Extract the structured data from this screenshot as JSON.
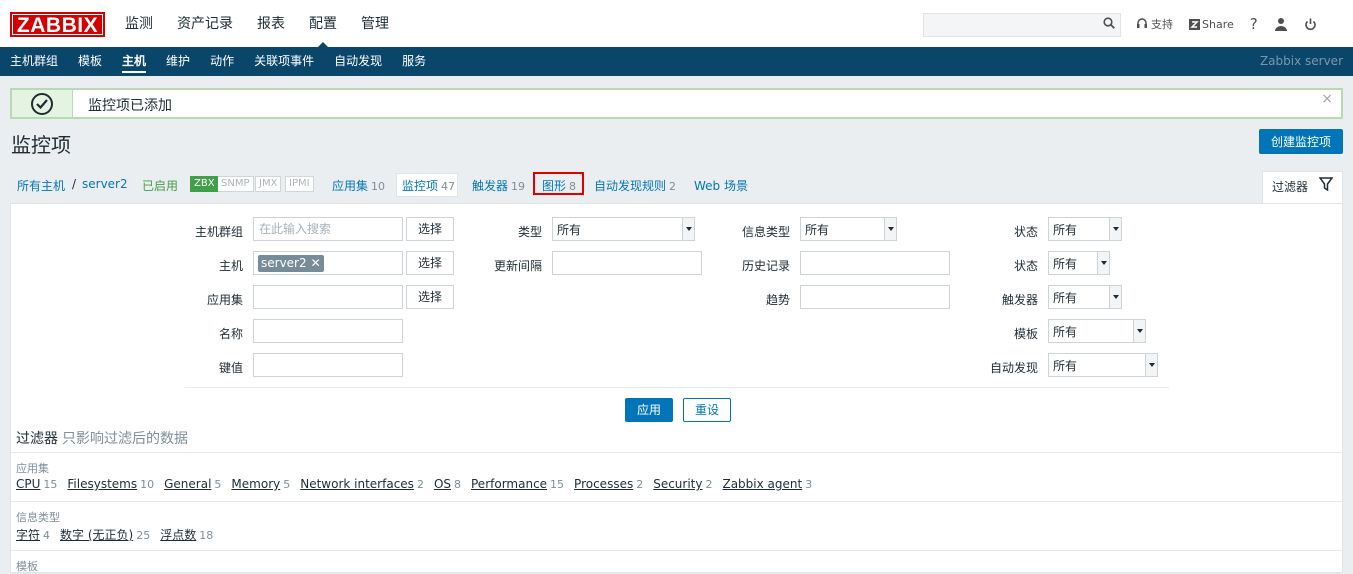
{
  "brand": {
    "logo": "ZABBIX"
  },
  "main_menu": [
    "监测",
    "资产记录",
    "报表",
    "配置",
    "管理"
  ],
  "top_icons": {
    "support": "支持",
    "share": "Share",
    "help": "?"
  },
  "sub_menu": [
    "主机群组",
    "模板",
    "主机",
    "维护",
    "动作",
    "关联项事件",
    "自动发现",
    "服务"
  ],
  "server_name": "Zabbix server",
  "message": {
    "text": "监控项已添加",
    "close": "×"
  },
  "page": {
    "title": "监控项",
    "create_button": "创建监控项"
  },
  "breadcrumb": {
    "all_hosts": "所有主机",
    "separator": "/",
    "host": "server2",
    "enabled": "已启用",
    "badges": [
      "ZBX",
      "SNMP",
      "JMX",
      "IPMI"
    ],
    "tabs": [
      {
        "label": "应用集",
        "count": "10"
      },
      {
        "label": "监控项",
        "count": "47"
      },
      {
        "label": "触发器",
        "count": "19"
      },
      {
        "label": "图形",
        "count": "8"
      },
      {
        "label": "自动发现规则",
        "count": "2"
      },
      {
        "label": "Web 场景",
        "count": ""
      }
    ]
  },
  "filter_tab": {
    "label": "过滤器"
  },
  "filter": {
    "host_group_label": "主机群组",
    "host_group_placeholder": "在此输入搜索",
    "select": "选择",
    "host_label": "主机",
    "host_chip": "server2",
    "app_label": "应用集",
    "name_label": "名称",
    "key_label": "键值",
    "type_label": "类型",
    "type_value": "所有",
    "update_label": "更新间隔",
    "info_type_label": "信息类型",
    "info_type_value": "所有",
    "history_label": "历史记录",
    "trend_label": "趋势",
    "state_label": "状态",
    "state_value": "所有",
    "status_label": "状态",
    "status_value": "所有",
    "trigger_label": "触发器",
    "trigger_value": "所有",
    "template_label": "模板",
    "template_value": "所有",
    "discovery_label": "自动发现",
    "discovery_value": "所有",
    "apply": "应用",
    "reset": "重设"
  },
  "subfilter": {
    "title": "过滤器",
    "note": "只影响过滤后的数据",
    "groups": [
      {
        "title": "应用集",
        "items": [
          {
            "name": "CPU",
            "count": "15"
          },
          {
            "name": "Filesystems",
            "count": "10"
          },
          {
            "name": "General",
            "count": "5"
          },
          {
            "name": "Memory",
            "count": "5"
          },
          {
            "name": "Network interfaces",
            "count": "2"
          },
          {
            "name": "OS",
            "count": "8"
          },
          {
            "name": "Performance",
            "count": "15"
          },
          {
            "name": "Processes",
            "count": "2"
          },
          {
            "name": "Security",
            "count": "2"
          },
          {
            "name": "Zabbix agent",
            "count": "3"
          }
        ]
      },
      {
        "title": "信息类型",
        "items": [
          {
            "name": "字符",
            "count": "4"
          },
          {
            "name": "数字 (无正负)",
            "count": "25"
          },
          {
            "name": "浮点数",
            "count": "18"
          }
        ]
      },
      {
        "title": "模板",
        "items": []
      }
    ]
  }
}
